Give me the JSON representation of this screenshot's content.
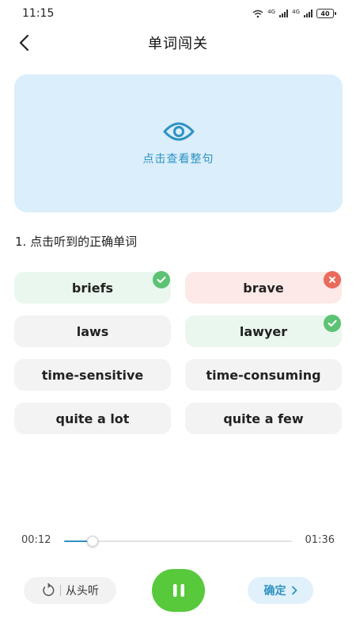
{
  "status": {
    "time": "11:15",
    "net1": "4G",
    "net2": "4G",
    "battery": "40"
  },
  "header": {
    "title": "单词闯关"
  },
  "reveal": {
    "label": "点击查看整句"
  },
  "question": {
    "text": "1. 点击听到的正确单词"
  },
  "options": [
    {
      "text": "briefs",
      "state": "correct"
    },
    {
      "text": "brave",
      "state": "wrong"
    },
    {
      "text": "laws",
      "state": "neutral"
    },
    {
      "text": "lawyer",
      "state": "correct"
    },
    {
      "text": "time-sensitive",
      "state": "neutral"
    },
    {
      "text": "time-consuming",
      "state": "neutral"
    },
    {
      "text": "quite a lot",
      "state": "neutral"
    },
    {
      "text": "quite a few",
      "state": "neutral"
    }
  ],
  "player": {
    "current": "00:12",
    "total": "01:36",
    "progress_fraction": 0.125
  },
  "controls": {
    "restart_label": "从头听",
    "confirm_label": "确定"
  },
  "colors": {
    "accent": "#2d92c4",
    "play": "#57c93b",
    "correct": "#5cc374",
    "wrong": "#ea6a5c"
  },
  "icons": [
    "back-arrow-icon",
    "eye-icon",
    "check-icon",
    "cross-icon",
    "replay-icon",
    "pause-icon",
    "chevron-right-icon"
  ]
}
